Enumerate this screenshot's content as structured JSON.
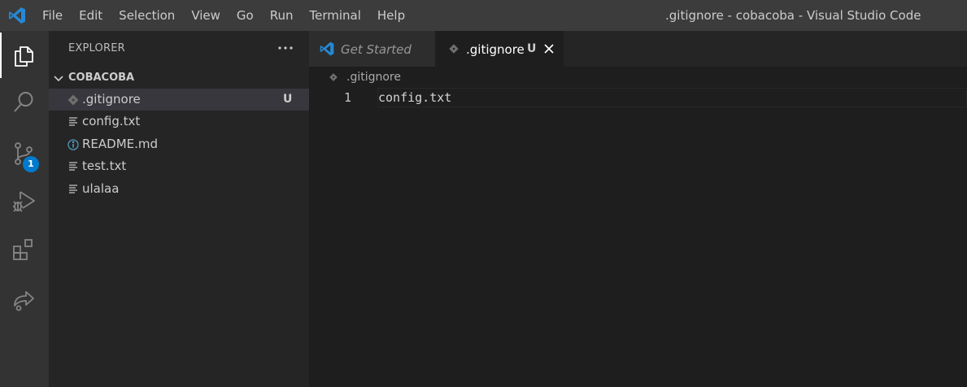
{
  "titlebar": {
    "menu": [
      "File",
      "Edit",
      "Selection",
      "View",
      "Go",
      "Run",
      "Terminal",
      "Help"
    ],
    "window_title": ".gitignore - cobacoba - Visual Studio Code"
  },
  "activitybar": {
    "items": [
      "explorer-icon",
      "search-icon",
      "source-control-icon",
      "run-debug-icon",
      "extensions-icon",
      "live-share-icon"
    ],
    "source_control_badge": "1"
  },
  "sidebar": {
    "title": "EXPLORER",
    "folder": "COBACOBA",
    "files": [
      {
        "name": ".gitignore",
        "icon": "git-icon",
        "status": "U",
        "selected": true
      },
      {
        "name": "config.txt",
        "icon": "text-file-icon",
        "status": ""
      },
      {
        "name": "README.md",
        "icon": "info-icon",
        "status": ""
      },
      {
        "name": "test.txt",
        "icon": "text-file-icon",
        "status": ""
      },
      {
        "name": "ulalaa",
        "icon": "text-file-icon",
        "status": ""
      }
    ]
  },
  "editor": {
    "tabs": [
      {
        "label": "Get Started",
        "active": false
      },
      {
        "label": ".gitignore",
        "status": "U",
        "active": true
      }
    ],
    "breadcrumb": ".gitignore",
    "lines": [
      {
        "number": "1",
        "text": "config.txt"
      }
    ]
  },
  "colors": {
    "accent": "#007acc",
    "titlebar": "#3c3c3c",
    "activitybar": "#333333",
    "sidebar": "#252526",
    "editor": "#1e1e1e"
  }
}
